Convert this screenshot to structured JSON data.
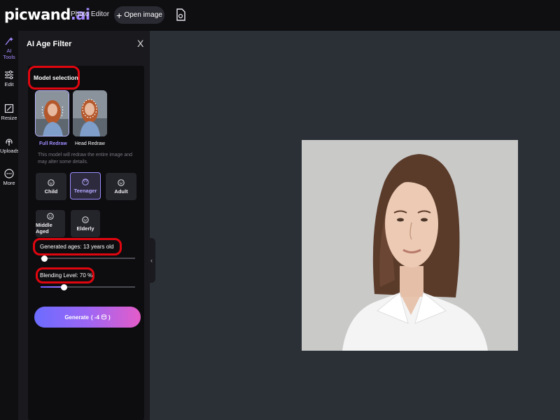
{
  "header": {
    "logo_main": "picwand",
    "logo_dot": ".ai",
    "photo_editor": "Photo Editor",
    "open_image": "Open image"
  },
  "rail": {
    "items": [
      {
        "label": "AI Tools",
        "icon": "ai-tools-icon",
        "active": true
      },
      {
        "label": "Edit",
        "icon": "sliders-icon"
      },
      {
        "label": "Resize",
        "icon": "resize-icon"
      },
      {
        "label": "Uploads",
        "icon": "upload-icon"
      },
      {
        "label": "More",
        "icon": "more-icon"
      }
    ]
  },
  "panel": {
    "title": "AI Age Filter",
    "close": "X",
    "model_selection": "Model selection",
    "models": [
      {
        "label": "Full Redraw",
        "selected": true
      },
      {
        "label": "Head Redraw",
        "selected": false
      }
    ],
    "note": "This model will redraw the entire image and may alter some details.",
    "ages": [
      {
        "label": "Child"
      },
      {
        "label": "Teenager",
        "selected": true
      },
      {
        "label": "Adult"
      },
      {
        "label": "Middle Aged"
      },
      {
        "label": "Elderly"
      }
    ],
    "generated_ages": "Generated ages: 13 years old",
    "generated_ages_value": 0.04,
    "blending": "Blending Level: 70 %",
    "blending_value": 0.25,
    "generate_label": "Generate",
    "generate_cost": "( -4",
    "generate_close": ")"
  },
  "colors": {
    "accent": "#a58bff",
    "highlight": "#e0060f",
    "bg": "#2b2f36"
  }
}
